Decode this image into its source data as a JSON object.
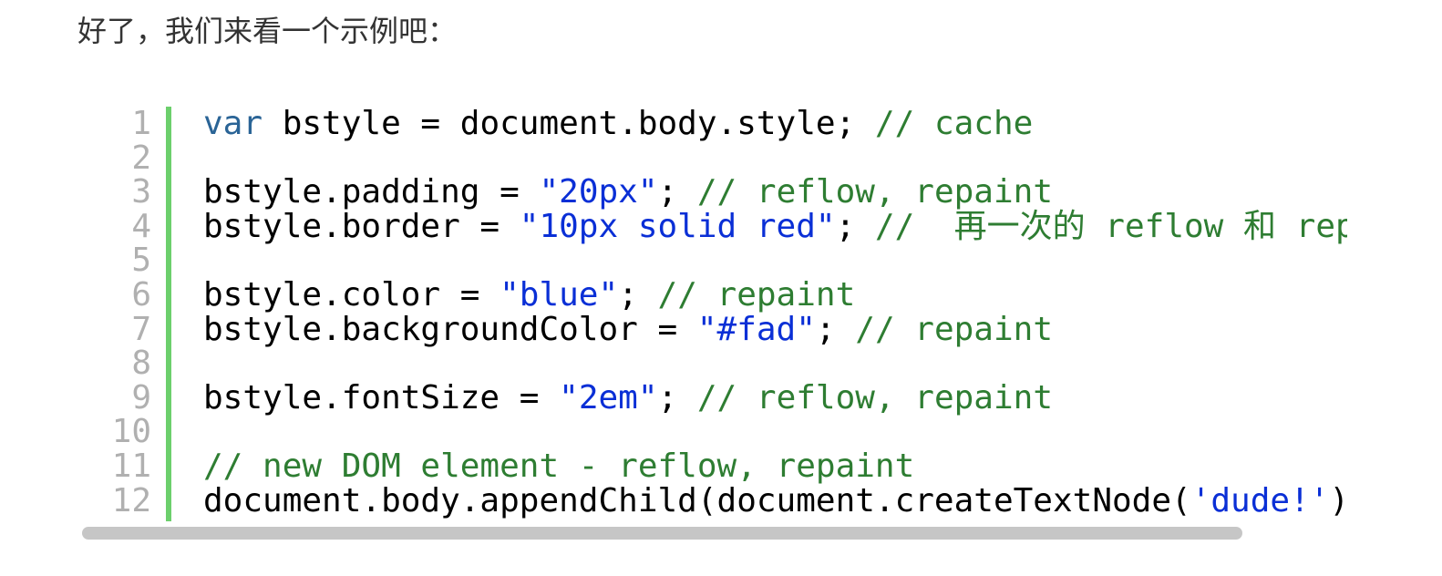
{
  "intro_text": "好了，我们来看一个示例吧：",
  "code": {
    "line_numbers": [
      "1",
      "2",
      "3",
      "4",
      "5",
      "6",
      "7",
      "8",
      "9",
      "10",
      "11",
      "12"
    ],
    "lines": [
      [
        {
          "t": "var",
          "c": "keyword"
        },
        {
          "t": " bstyle = document.body.style; ",
          "c": "plain"
        },
        {
          "t": "// cache",
          "c": "comment"
        }
      ],
      [],
      [
        {
          "t": "bstyle.padding = ",
          "c": "plain"
        },
        {
          "t": "\"20px\"",
          "c": "string"
        },
        {
          "t": "; ",
          "c": "plain"
        },
        {
          "t": "// reflow, repaint",
          "c": "comment"
        }
      ],
      [
        {
          "t": "bstyle.border = ",
          "c": "plain"
        },
        {
          "t": "\"10px solid red\"",
          "c": "string"
        },
        {
          "t": "; ",
          "c": "plain"
        },
        {
          "t": "//  再一次的 reflow 和 repaint",
          "c": "comment"
        }
      ],
      [],
      [
        {
          "t": "bstyle.color = ",
          "c": "plain"
        },
        {
          "t": "\"blue\"",
          "c": "string"
        },
        {
          "t": "; ",
          "c": "plain"
        },
        {
          "t": "// repaint",
          "c": "comment"
        }
      ],
      [
        {
          "t": "bstyle.backgroundColor = ",
          "c": "plain"
        },
        {
          "t": "\"#fad\"",
          "c": "string"
        },
        {
          "t": "; ",
          "c": "plain"
        },
        {
          "t": "// repaint",
          "c": "comment"
        }
      ],
      [],
      [
        {
          "t": "bstyle.fontSize = ",
          "c": "plain"
        },
        {
          "t": "\"2em\"",
          "c": "string"
        },
        {
          "t": "; ",
          "c": "plain"
        },
        {
          "t": "// reflow, repaint",
          "c": "comment"
        }
      ],
      [],
      [
        {
          "t": "// new DOM element - reflow, repaint",
          "c": "comment"
        }
      ],
      [
        {
          "t": "document.body.appendChild(document.createTextNode(",
          "c": "plain"
        },
        {
          "t": "'dude!'",
          "c": "string"
        },
        {
          "t": "));",
          "c": "plain"
        }
      ]
    ]
  },
  "colors": {
    "keyword": "#2a6496",
    "string": "#0a2fd6",
    "comment": "#2e7d32",
    "gutter_bar": "#6ccf6c",
    "line_number": "#b0b0b0"
  },
  "scrollbar": {
    "horizontal_thumb_fraction": 0.92
  }
}
